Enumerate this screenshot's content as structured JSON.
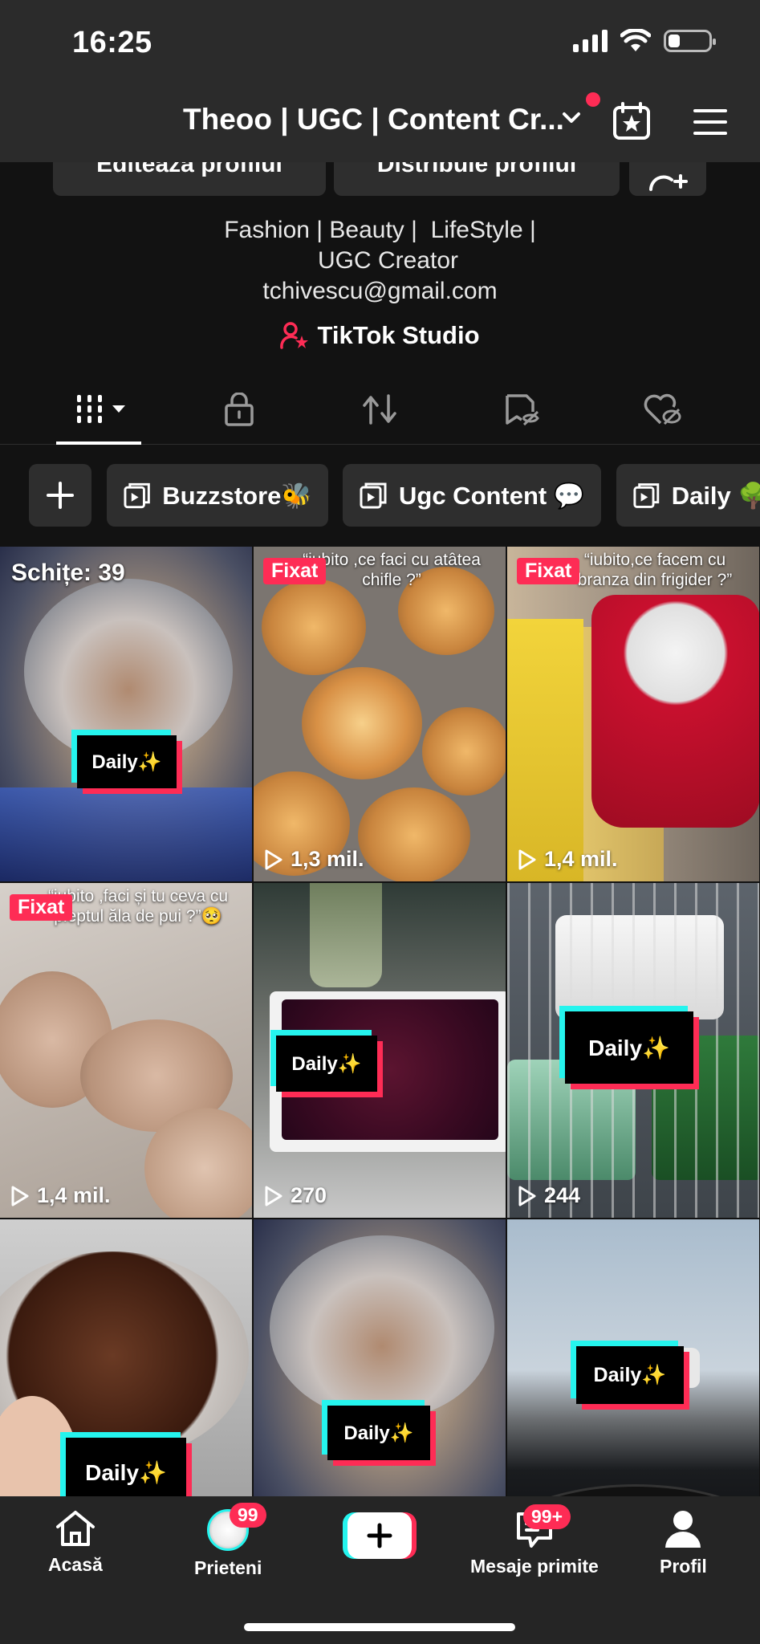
{
  "status_bar": {
    "time": "16:25"
  },
  "header": {
    "title": "Theoo | UGC | Content Cr..."
  },
  "profile_buttons": [
    {
      "label": "Editează profilul"
    },
    {
      "label": "Distribuie profilul"
    }
  ],
  "bio": {
    "lines": [
      "Fashion | Beauty |  LifeStyle |",
      "UGC Creator",
      "tchivescu@gmail.com"
    ],
    "studio_link": "TikTok Studio"
  },
  "tabs": [
    {
      "icon": "grid-icon",
      "active": true
    },
    {
      "icon": "lock-icon"
    },
    {
      "icon": "repost-icon"
    },
    {
      "icon": "saved-icon"
    },
    {
      "icon": "liked-icon"
    }
  ],
  "collections": [
    {
      "label": "Buzzstore🐝"
    },
    {
      "label": "Ugc Content 💬"
    },
    {
      "label": "Daily 🌳"
    }
  ],
  "videos": [
    {
      "drafts": "Schițe: 39",
      "daily": "Daily✨"
    },
    {
      "pinned": "Fixat",
      "caption": "“iubito ,ce faci cu atâtea chifle ?”",
      "views": "1,3 mil."
    },
    {
      "pinned": "Fixat",
      "caption": "“iubito,ce facem cu branza din frigider ?”",
      "views": "1,4 mil."
    },
    {
      "pinned": "Fixat",
      "caption": "“iubito ,faci și tu ceva cu pieptul ăla de pui ?”🥺",
      "views": "1,4 mil."
    },
    {
      "daily": "Daily✨",
      "views": "270"
    },
    {
      "daily": "Daily✨",
      "views": "244"
    },
    {
      "daily": "Daily✨"
    },
    {
      "daily": "Daily✨"
    },
    {
      "daily": "Daily✨"
    }
  ],
  "bottom_nav": {
    "home": "Acasă",
    "friends": "Prieteni",
    "friends_badge": "99",
    "inbox": "Mesaje primite",
    "inbox_badge": "99+",
    "profile": "Profil"
  },
  "colors": {
    "accent": "#fe2c55",
    "cyan": "#25f4ee",
    "background": "#121212"
  }
}
